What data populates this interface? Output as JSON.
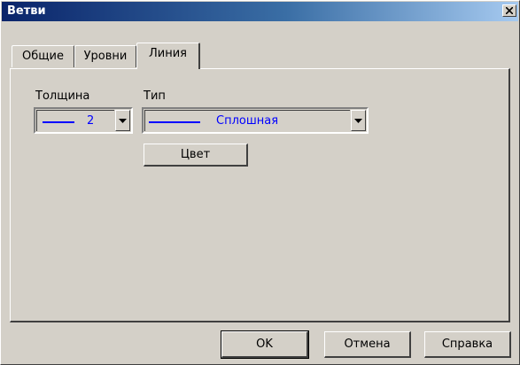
{
  "window": {
    "title": "Ветви"
  },
  "tabs": [
    {
      "label": "Общие",
      "active": false
    },
    {
      "label": "Уровни",
      "active": false
    },
    {
      "label": "Линия",
      "active": true
    }
  ],
  "line_tab": {
    "thickness": {
      "label": "Толщина",
      "value": "2"
    },
    "type": {
      "label": "Тип",
      "value": "Сплошная"
    },
    "color_button": "Цвет"
  },
  "buttons": {
    "ok": "OK",
    "cancel": "Отмена",
    "help": "Справка"
  },
  "colors": {
    "value_text": "#0000ff",
    "title_bar": "#0a246a",
    "face": "#d4d0c8"
  },
  "icons": {
    "close": "close-icon",
    "dropdown": "chevron-down-icon"
  }
}
